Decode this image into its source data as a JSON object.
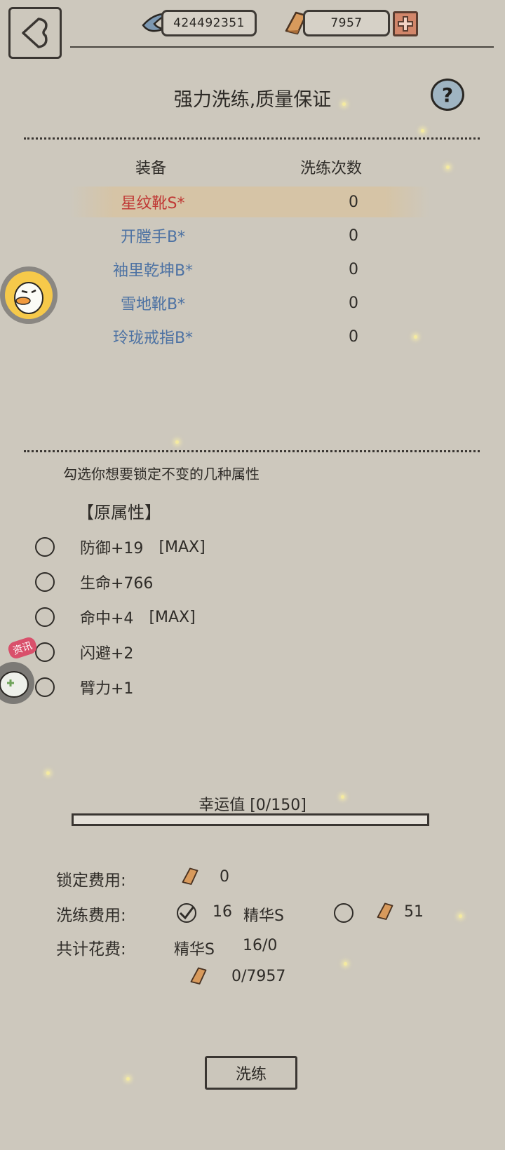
{
  "header": {
    "moonstone_amount": "424492351",
    "gold_amount": "7957"
  },
  "page_title": "强力洗练,质量保证",
  "help_label": "?",
  "equipment": {
    "col_equip": "装备",
    "col_count": "洗练次数",
    "items": [
      {
        "name": "星纹靴S*",
        "count": "0",
        "selected": true
      },
      {
        "name": "开膛手B*",
        "count": "0"
      },
      {
        "name": "袖里乾坤B*",
        "count": "0"
      },
      {
        "name": "雪地靴B*",
        "count": "0"
      },
      {
        "name": "玲珑戒指B*",
        "count": "0"
      }
    ]
  },
  "lock_hint": "勾选你想要锁定不变的几种属性",
  "original_attrs_title": "【原属性】",
  "attributes": [
    {
      "text": "防御+19",
      "max": "[MAX]"
    },
    {
      "text": "生命+766",
      "max": ""
    },
    {
      "text": "命中+4",
      "max": "[MAX]"
    },
    {
      "text": "闪避+2",
      "max": ""
    },
    {
      "text": "臂力+1",
      "max": ""
    }
  ],
  "luck": {
    "label": "幸运值 [0/150]",
    "progress": 0
  },
  "costs": {
    "lock_label": "锁定费用:",
    "lock_value": "0",
    "wash_label": "洗练费用:",
    "wash_essence_amount": "16",
    "wash_essence_name": "精华S",
    "wash_gold_amount": "51",
    "total_label": "共计花费:",
    "total_essence_name": "精华S",
    "total_essence_value": "16/0",
    "total_gold_value": "0/7957"
  },
  "wash_button": "洗练",
  "news_badge": "资讯",
  "colors": {
    "background": "#cdc8bd",
    "selected_item": "#c03a36",
    "item_blue": "#4d72a3",
    "plus_button": "#d2866a"
  },
  "icons": [
    "back-arrow-icon",
    "moonstone-icon",
    "gold-bar-icon",
    "plus-icon",
    "help-icon",
    "duck-avatar-icon",
    "gamepad-icon",
    "checkmark-icon"
  ]
}
